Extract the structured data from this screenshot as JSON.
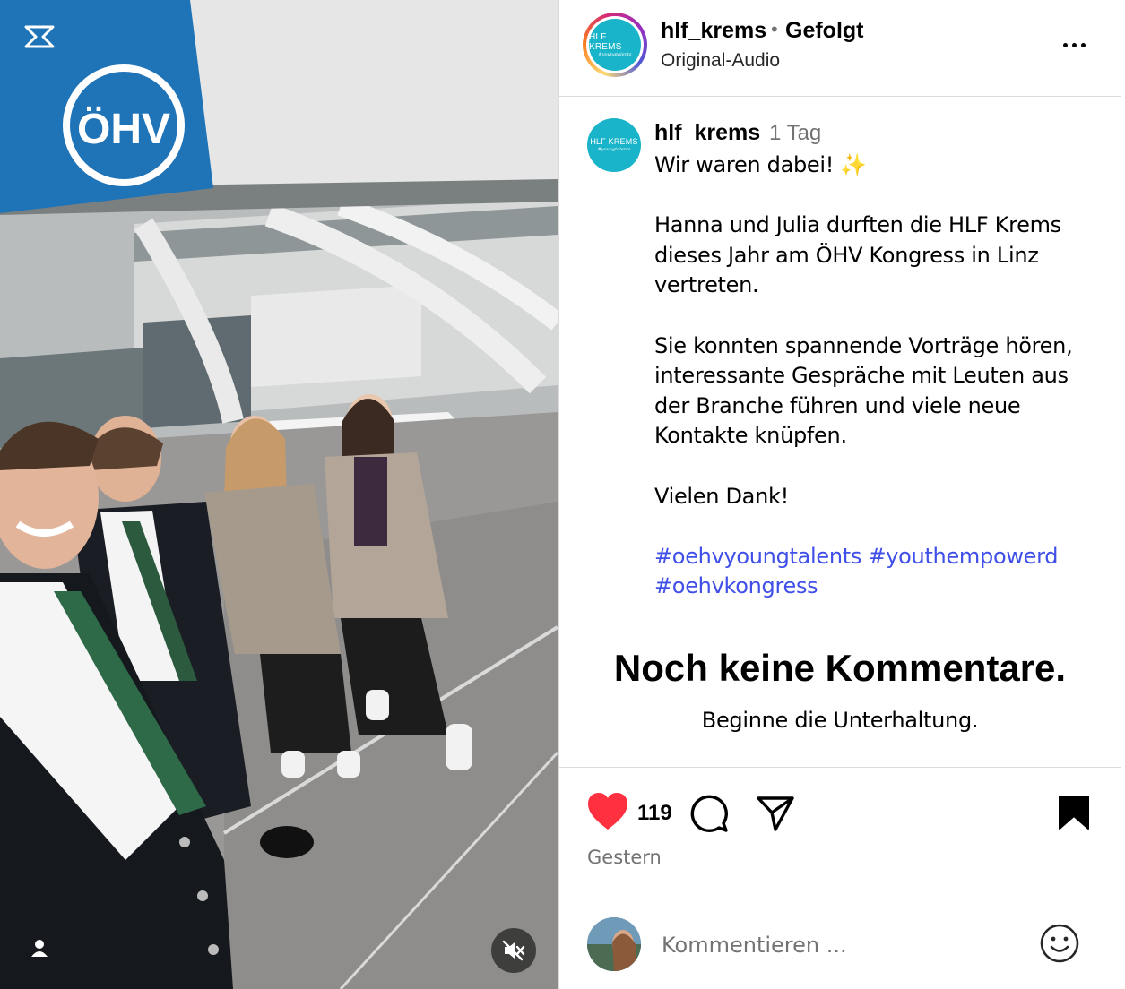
{
  "media": {
    "banner_text": "ÖHV",
    "icons": {
      "corner_logo": "capcut-logo-icon",
      "user_tag": "user-tag-icon",
      "mute": "speaker-muted-icon"
    }
  },
  "header": {
    "avatar_line1": "HLF KREMS",
    "avatar_line2": "#youngtalents",
    "username": "hlf_krems",
    "separator": "•",
    "follow_status": "Gefolgt",
    "audio": "Original-Audio",
    "more_icon": "more-horizontal-icon"
  },
  "caption": {
    "username": "hlf_krems",
    "time": "1 Tag",
    "line1": "Wir waren dabei! ✨",
    "para1": "Hanna und Julia durften die HLF Krems dieses Jahr am ÖHV Kongress in Linz vertreten.",
    "para2": "Sie konnten spannende Vorträge hören, interessante Gespräche mit Leuten aus der Branche führen und viele neue Kontakte knüpfen.",
    "para3": "Vielen Dank!",
    "hashtags": [
      "#oehvyoungtalents",
      "#youthempowerd",
      "#oehvkongress"
    ]
  },
  "comments": {
    "empty_title": "Noch keine Kommentare.",
    "empty_subtitle": "Beginne die Unterhaltung."
  },
  "actions": {
    "like_count": "119",
    "date": "Gestern",
    "icons": [
      "heart-filled-icon",
      "comment-icon",
      "share-icon",
      "bookmark-filled-icon"
    ],
    "like_color": "#ff3040"
  },
  "comment_bar": {
    "placeholder": "Kommentieren ...",
    "emoji_icon": "smiley-icon"
  }
}
